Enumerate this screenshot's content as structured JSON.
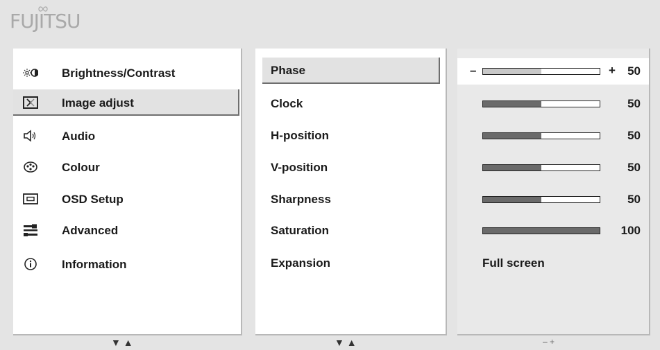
{
  "brand": {
    "logo_text": "FUJITSU"
  },
  "menu": {
    "items": [
      {
        "label": "Brightness/Contrast",
        "icon": "brightness-contrast-icon"
      },
      {
        "label": "Image adjust",
        "icon": "image-adjust-icon",
        "selected": true
      },
      {
        "label": "Audio",
        "icon": "speaker-icon"
      },
      {
        "label": "Colour",
        "icon": "palette-icon"
      },
      {
        "label": "OSD Setup",
        "icon": "osd-setup-icon"
      },
      {
        "label": "Advanced",
        "icon": "advanced-settings-icon"
      },
      {
        "label": "Information",
        "icon": "info-icon"
      }
    ],
    "nav_hint": "▼ ▲"
  },
  "submenu": {
    "items": [
      {
        "label": "Phase",
        "selected": true
      },
      {
        "label": "Clock"
      },
      {
        "label": "H-position"
      },
      {
        "label": "V-position"
      },
      {
        "label": "Sharpness"
      },
      {
        "label": "Saturation"
      },
      {
        "label": "Expansion"
      }
    ],
    "nav_hint": "▼ ▲"
  },
  "values": {
    "items": [
      {
        "type": "slider",
        "value": 50,
        "value_text": "50",
        "max": 100,
        "selected": true,
        "minus": "–",
        "plus": "+"
      },
      {
        "type": "slider",
        "value": 50,
        "value_text": "50",
        "max": 100
      },
      {
        "type": "slider",
        "value": 50,
        "value_text": "50",
        "max": 100
      },
      {
        "type": "slider",
        "value": 50,
        "value_text": "50",
        "max": 100
      },
      {
        "type": "slider",
        "value": 50,
        "value_text": "50",
        "max": 100
      },
      {
        "type": "slider",
        "value": 100,
        "value_text": "100",
        "max": 100
      },
      {
        "type": "text",
        "value_text": "Full screen"
      }
    ],
    "nav_hint": "–  +"
  }
}
